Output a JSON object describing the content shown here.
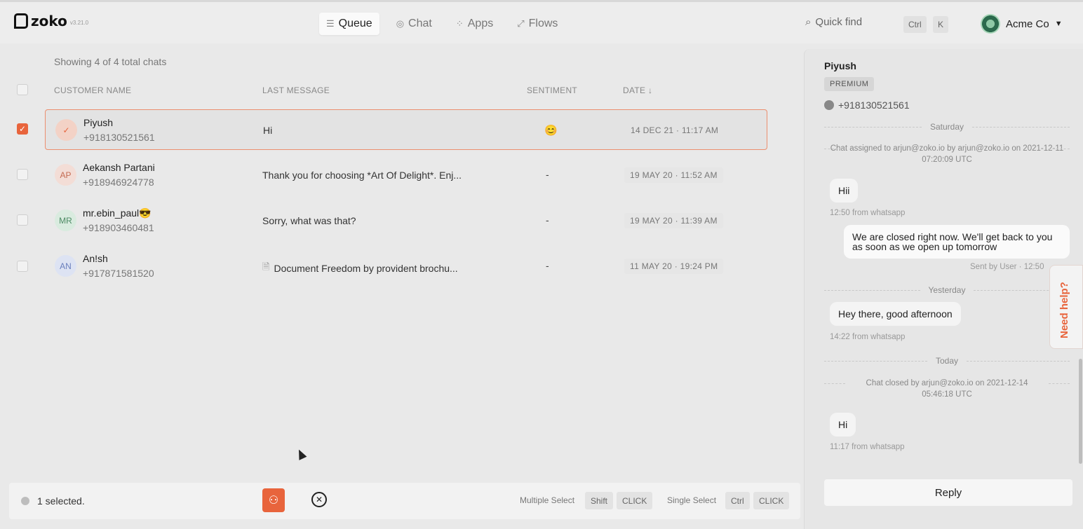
{
  "brand": {
    "name": "zoko",
    "version": "v3.21.0"
  },
  "nav": [
    {
      "label": "Queue",
      "icon": "queue-icon",
      "active": true
    },
    {
      "label": "Chat",
      "icon": "chat-icon",
      "active": false
    },
    {
      "label": "Apps",
      "icon": "apps-icon",
      "active": false
    },
    {
      "label": "Flows",
      "icon": "flows-icon",
      "active": false
    }
  ],
  "quick_find": {
    "label": "Quick find",
    "keys": [
      "Ctrl",
      "K"
    ]
  },
  "account": {
    "name": "Acme Co"
  },
  "list": {
    "showing": "Showing 4 of 4 total chats",
    "headers": {
      "customer": "CUSTOMER NAME",
      "message": "LAST MESSAGE",
      "sentiment": "SENTIMENT",
      "date": "DATE ↓"
    },
    "rows": [
      {
        "initials": "✓",
        "name": "Piyush",
        "phone": "+918130521561",
        "message": "Hi",
        "sentiment": "😊",
        "date": "14 DEC 21 · 11:17 AM",
        "selected": true
      },
      {
        "initials": "AP",
        "name": "Aekansh Partani",
        "phone": "+918946924778",
        "message": "Thank you for choosing *Art Of Delight*. Enj...",
        "sentiment": "-",
        "date": "19 MAY 20 · 11:52 AM",
        "selected": false
      },
      {
        "initials": "MR",
        "name": "mr.ebin_paul😎",
        "phone": "+918903460481",
        "message": "Sorry, what was that?",
        "sentiment": "-",
        "date": "19 MAY 20 · 11:39 AM",
        "selected": false
      },
      {
        "initials": "AN",
        "name": "An!sh",
        "phone": "+917871581520",
        "message": "Document Freedom by provident brochu...",
        "sentiment": "-",
        "date": "11 MAY 20 · 19:24 PM",
        "selected": false
      }
    ]
  },
  "bottom": {
    "selected_text": "1 selected.",
    "multi_label": "Multiple Select",
    "multi_keys": [
      "Shift",
      "CLICK"
    ],
    "single_label": "Single Select",
    "single_keys": [
      "Ctrl",
      "CLICK"
    ]
  },
  "panel": {
    "name": "Piyush",
    "badge": "PREMIUM",
    "phone": "+918130521561",
    "sep_saturday": "Saturday",
    "sys_assigned": "Chat assigned to arjun@zoko.io by arjun@zoko.io on 2021-12-11 07:20:09 UTC",
    "msg1": "Hii",
    "meta1": "12:50 from whatsapp",
    "msg2": "We are closed right now. We'll get back to you as soon as we open up tomorrow",
    "meta2": "Sent by User · 12:50",
    "sep_yesterday": "Yesterday",
    "msg3": "Hey there, good afternoon",
    "meta3": "14:22 from whatsapp",
    "sep_today": "Today",
    "sys_closed": "Chat closed by arjun@zoko.io on 2021-12-14 05:46:18 UTC",
    "msg4": "Hi",
    "meta4": "11:17 from whatsapp",
    "reply": "Reply"
  },
  "help": "Need help?",
  "colors": {
    "accent": "#e8643c"
  }
}
